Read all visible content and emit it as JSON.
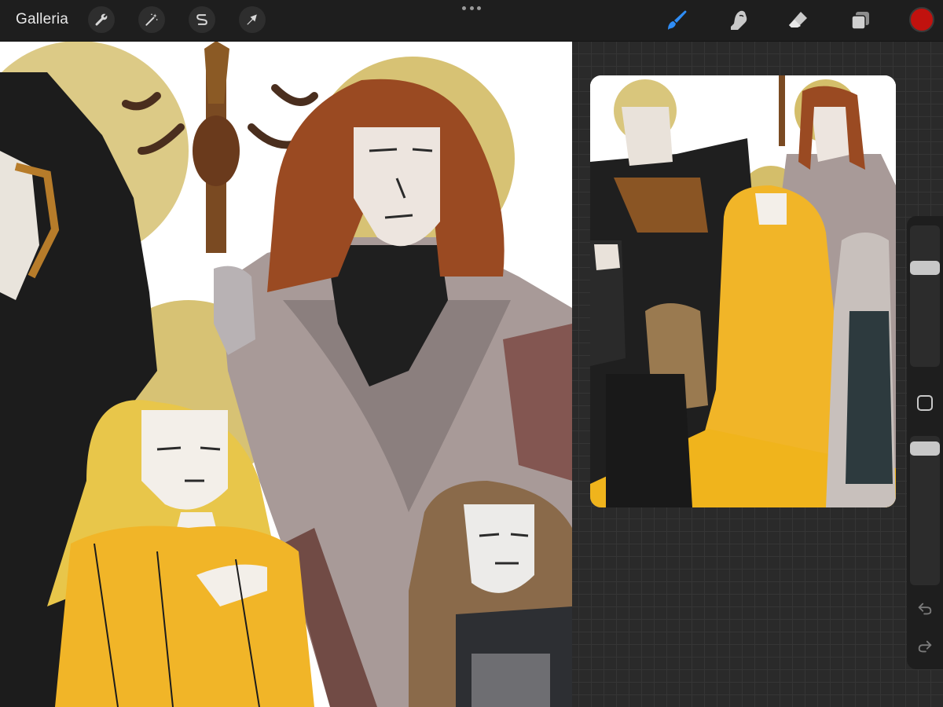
{
  "toolbar": {
    "gallery_label": "Galleria",
    "left_tools": [
      {
        "name": "actions",
        "icon": "wrench-icon"
      },
      {
        "name": "adjustments",
        "icon": "magic-wand-icon"
      },
      {
        "name": "selection",
        "icon": "selection-s-icon"
      },
      {
        "name": "transform",
        "icon": "arrow-cursor-icon"
      }
    ],
    "menu_icon": "more-dots-icon",
    "right_tools": [
      {
        "name": "brush",
        "icon": "brush-icon",
        "active": true
      },
      {
        "name": "smudge",
        "icon": "smudge-finger-icon",
        "active": false
      },
      {
        "name": "eraser",
        "icon": "eraser-icon",
        "active": false
      },
      {
        "name": "layers",
        "icon": "layers-icon",
        "active": false
      }
    ],
    "current_color": "#c1120e",
    "active_tool_color": "#2f8df5"
  },
  "sidebar": {
    "size_slider_level": 0.72,
    "opacity_slider_level": 0.96,
    "modifier_icon": "square-modifier-icon",
    "undo_icon": "undo-arrow-icon",
    "redo_icon": "redo-arrow-icon"
  },
  "reference": {
    "title": ""
  }
}
